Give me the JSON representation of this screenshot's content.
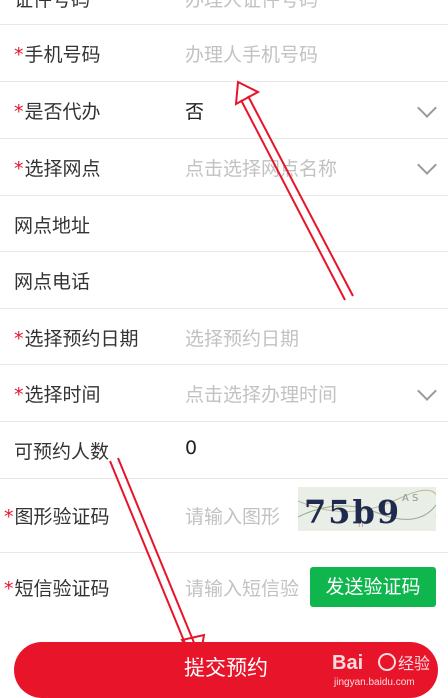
{
  "rows": {
    "id_number": {
      "label": "证件号码",
      "placeholder": "办理人证件号码"
    },
    "phone": {
      "required": "*",
      "label": "手机号码",
      "placeholder": "办理人手机号码"
    },
    "proxy": {
      "required": "*",
      "label": "是否代办",
      "value": "否"
    },
    "outlet": {
      "required": "*",
      "label": "选择网点",
      "placeholder": "点击选择网点名称"
    },
    "address": {
      "label": "网点地址"
    },
    "phone_outlet": {
      "label": "网点电话"
    },
    "date": {
      "required": "*",
      "label": "选择预约日期",
      "placeholder": "选择预约日期"
    },
    "time": {
      "required": "*",
      "label": "选择时间",
      "placeholder": "点击选择办理时间"
    },
    "capacity": {
      "label": "可预约人数",
      "value": "0"
    },
    "captcha": {
      "required": "*",
      "label": "图形验证码",
      "placeholder": "请输入图形",
      "image_text": "75b9"
    },
    "sms": {
      "required": "*",
      "label": "短信验证码",
      "placeholder": "请输入短信验",
      "button": "发送验证码"
    }
  },
  "submit_label": "提交预约",
  "watermark": {
    "brand": "Bai",
    "brand_cn": "经验",
    "url": "jingyan.baidu.com"
  },
  "colors": {
    "accent": "#e8142a",
    "green": "#0fb64e",
    "placeholder": "#c2c2c2"
  }
}
